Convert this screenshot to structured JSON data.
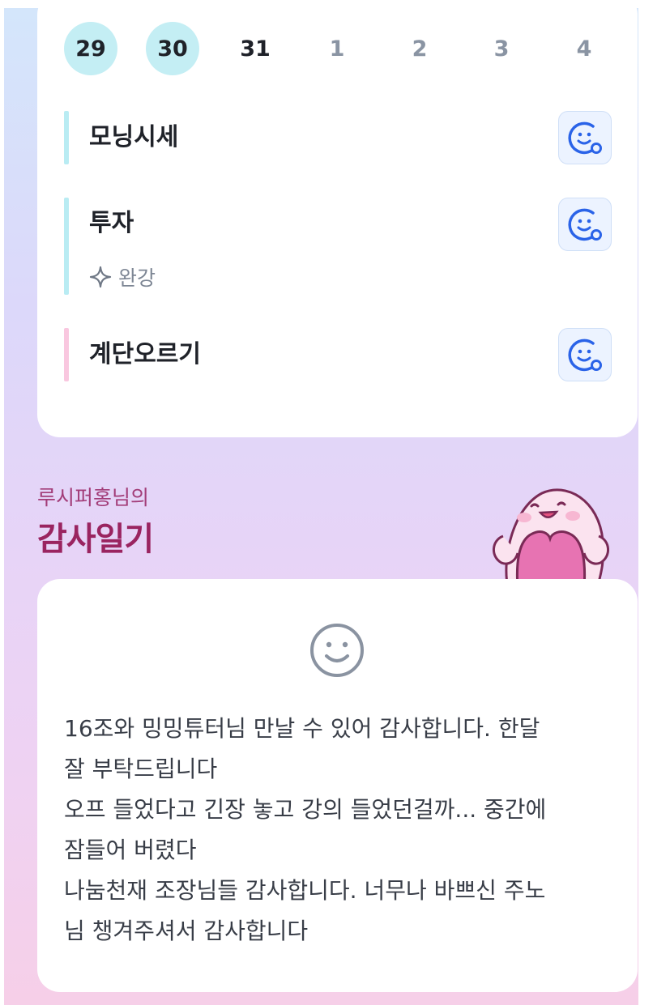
{
  "calendar": {
    "dates": [
      {
        "label": "29",
        "state": "completed"
      },
      {
        "label": "30",
        "state": "completed"
      },
      {
        "label": "31",
        "state": "today"
      },
      {
        "label": "1",
        "state": "future"
      },
      {
        "label": "2",
        "state": "future"
      },
      {
        "label": "3",
        "state": "future"
      },
      {
        "label": "4",
        "state": "future"
      }
    ]
  },
  "habits": [
    {
      "name": "모닝시세",
      "color": "#b9ecf3",
      "icon": "smile-check-icon"
    },
    {
      "name": "투자",
      "color": "#b9ecf3",
      "icon": "smile-check-icon",
      "status": "완강",
      "status_icon": "sparkle-icon"
    },
    {
      "name": "계단오르기",
      "color": "#f9c7df",
      "icon": "smile-check-icon"
    }
  ],
  "gratitude": {
    "owner": "루시퍼홍님의",
    "title": "감사일기",
    "mood_icon": "smile-icon",
    "entry": "16조와 밍밍튜터님 만날 수 있어 감사합니다. 한달\n잘 부탁드립니다\n오프 들었다고 긴장 놓고 강의 들었던걸까... 중간에\n잠들어 버렸다\n나눔천재 조장님들 감사합니다. 너무나 바쁘신 주노\n님 챙겨주셔서 감사합니다"
  },
  "colors": {
    "accent_blue": "#2a63e8",
    "active_date_bg": "#c4eef4",
    "title_color": "#9a2460",
    "card_bg": "#ffffff"
  }
}
